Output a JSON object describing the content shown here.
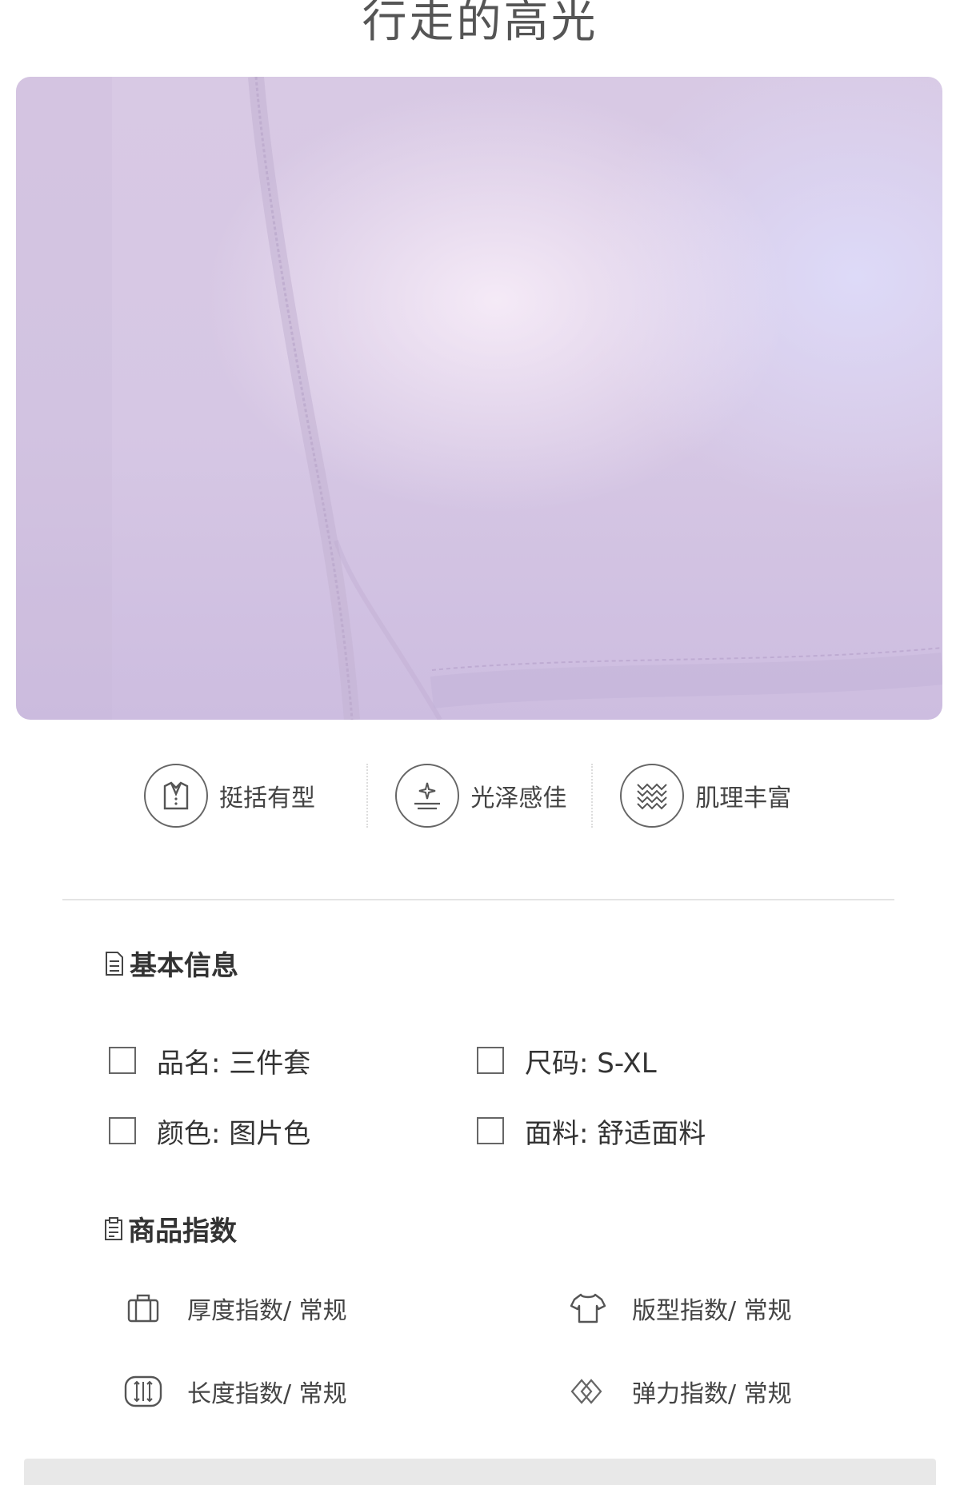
{
  "header": {
    "title": "行走的高光"
  },
  "features": [
    {
      "label": "挺括有型",
      "icon": "shirt-collar-icon"
    },
    {
      "label": "光泽感佳",
      "icon": "sparkle-icon"
    },
    {
      "label": "肌理丰富",
      "icon": "texture-icon"
    }
  ],
  "basic_info": {
    "title": "基本信息",
    "items": [
      {
        "text": "品名: 三件套"
      },
      {
        "text": "尺码: S-XL"
      },
      {
        "text": "颜色: 图片色"
      },
      {
        "text": "面料: 舒适面料"
      }
    ]
  },
  "product_index": {
    "title": "商品指数",
    "items": [
      {
        "text": "厚度指数/ 常规",
        "icon": "thickness-icon"
      },
      {
        "text": "版型指数/ 常规",
        "icon": "tshirt-icon"
      },
      {
        "text": "长度指数/ 常规",
        "icon": "length-icon"
      },
      {
        "text": "弹力指数/ 常规",
        "icon": "elasticity-icon"
      }
    ]
  },
  "colors": {
    "fabric": "#d8c9e4",
    "text": "#333333",
    "divider": "#e4e4e4"
  }
}
